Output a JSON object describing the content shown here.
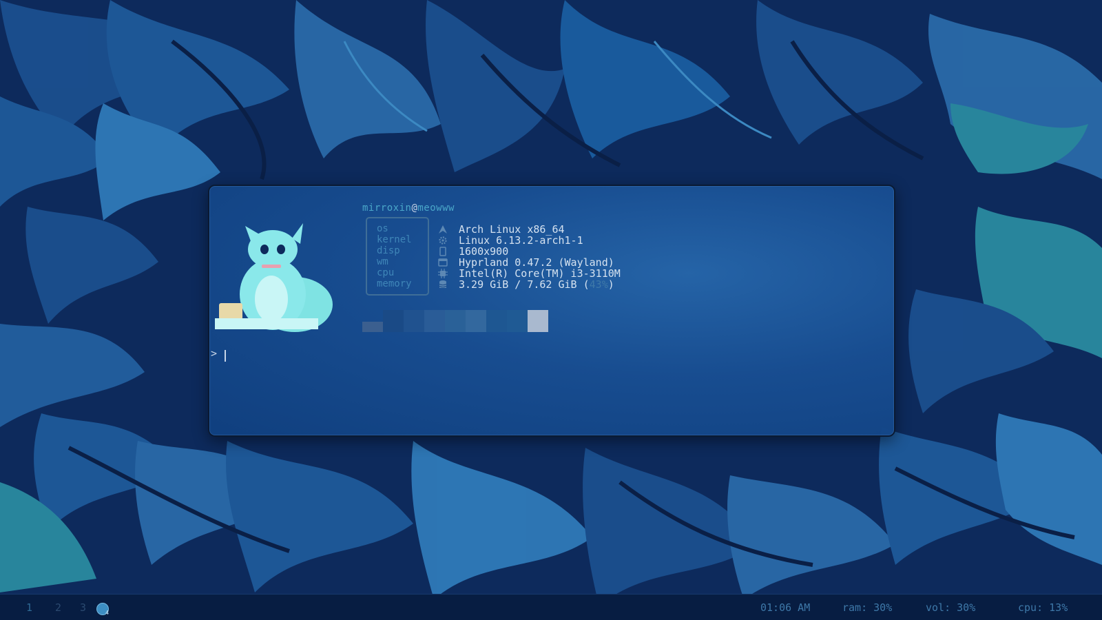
{
  "terminal": {
    "user": "mirroxin",
    "at": "@",
    "host": "meowww",
    "fields": [
      {
        "label": "os",
        "icon": "arch-logo-icon",
        "value": "Arch Linux x86_64"
      },
      {
        "label": "kernel",
        "icon": "gear-icon",
        "value": "Linux 6.13.2-arch1-1"
      },
      {
        "label": "disp",
        "icon": "monitor-icon",
        "value": "1600x900"
      },
      {
        "label": "wm",
        "icon": "window-icon",
        "value": "Hyprland 0.47.2 (Wayland)"
      },
      {
        "label": "cpu",
        "icon": "cpu-chip-icon",
        "value": "Intel(R) Core(TM) i3-3110M"
      },
      {
        "label": "memory",
        "icon": "database-icon",
        "value_main": "3.29 GiB / 7.62 GiB (",
        "value_pct": "43%",
        "value_close": ")"
      }
    ],
    "palette_colors": [
      "#3b5f8f",
      "#1a4a86",
      "#20528f",
      "#2a5c97",
      "#2a6198",
      "#33689e",
      "#1e5792",
      "#1f5a94",
      "#a9b9cf"
    ],
    "prompt_symbol": ">"
  },
  "statusbar": {
    "workspaces": [
      "1",
      "2",
      "3"
    ],
    "active_workspace_count": "4",
    "clock": "01:06 AM",
    "ram": "ram: 30%",
    "vol": "vol: 30%",
    "cpu": "cpu: 13%"
  },
  "colors": {
    "accent": "#4aa7c9",
    "text": "#d5e2f0",
    "label": "#3f86b8",
    "bar_bg": "#071d42"
  }
}
